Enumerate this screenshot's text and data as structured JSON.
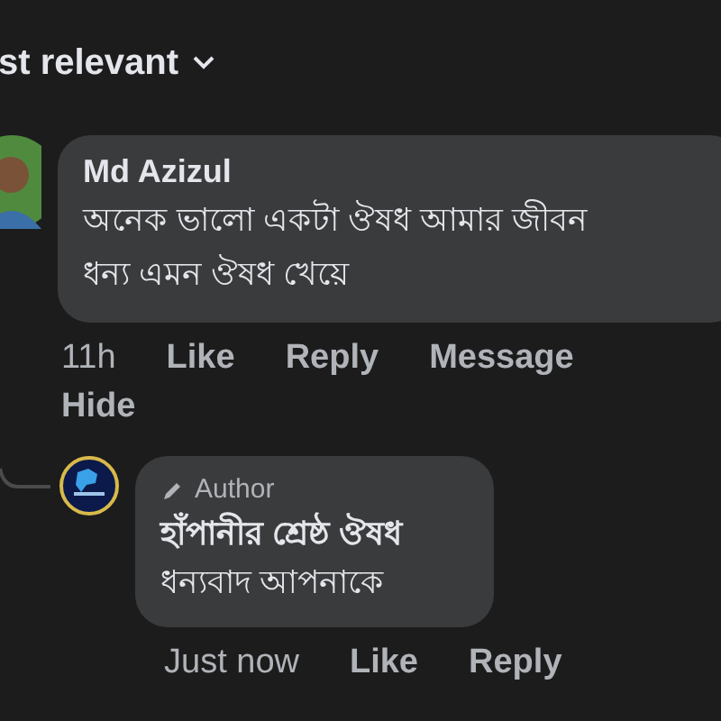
{
  "sort": {
    "label": "st relevant"
  },
  "comments": [
    {
      "author": "Md Azizul",
      "lines": [
        "অনেক ভালো একটা ঔষধ আমার জীবন",
        "ধন্য এমন ঔষধ খেয়ে"
      ],
      "time": "11h",
      "actions": [
        "Like",
        "Reply",
        "Message",
        "Hide"
      ]
    },
    {
      "badge": "Author",
      "author": "হাঁপানীর শ্রেষ্ঠ ঔষধ",
      "lines": [
        "ধন্যবাদ আপনাকে"
      ],
      "time": "Just now",
      "actions": [
        "Like",
        "Reply"
      ],
      "is_reply": true
    }
  ]
}
